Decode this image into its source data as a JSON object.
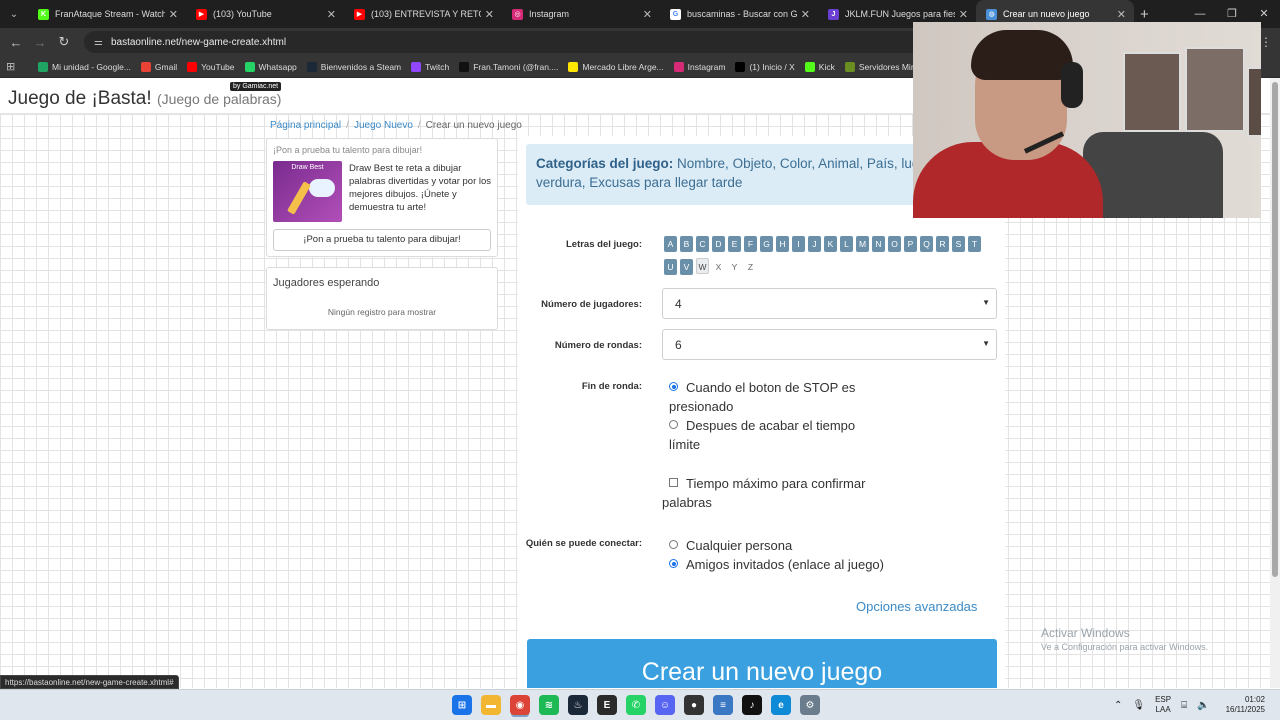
{
  "browser": {
    "tabs": [
      {
        "label": "FranAtaque Stream - Watch Liv",
        "fav_color": "#53fc18",
        "fav_glyph": "K"
      },
      {
        "label": "(103) YouTube",
        "fav_color": "#ff0000",
        "fav_glyph": "▶"
      },
      {
        "label": "(103) ENTREVISTA Y RETOS EN",
        "fav_color": "#ff0000",
        "fav_glyph": "▶"
      },
      {
        "label": "Instagram",
        "fav_color": "#d62976",
        "fav_glyph": "◎"
      },
      {
        "label": "buscaminas - Buscar con Goog",
        "fav_color": "#ffffff",
        "fav_glyph": "G"
      },
      {
        "label": "JKLM.FUN Juegos para fiestas e",
        "fav_color": "#6a3fd1",
        "fav_glyph": "J"
      },
      {
        "label": "Crear un nuevo juego",
        "fav_color": "#4a90d9",
        "fav_glyph": "◍"
      }
    ],
    "url": "bastaonline.net/new-game-create.xhtml",
    "bookmarks": [
      {
        "label": "Mi unidad - Google...",
        "color": "#1fa463"
      },
      {
        "label": "Gmail",
        "color": "#ea4335"
      },
      {
        "label": "YouTube",
        "color": "#ff0000"
      },
      {
        "label": "Whatsapp",
        "color": "#25d366"
      },
      {
        "label": "Bienvenidos a Steam",
        "color": "#1b2838"
      },
      {
        "label": "Twitch",
        "color": "#9146ff"
      },
      {
        "label": "Fran.Tamoni (@fran....",
        "color": "#111111"
      },
      {
        "label": "Mercado Libre Arge...",
        "color": "#ffe600"
      },
      {
        "label": "Instagram",
        "color": "#d62976"
      },
      {
        "label": "(1) Inicio / X",
        "color": "#000000"
      },
      {
        "label": "Kick",
        "color": "#53fc18"
      },
      {
        "label": "Servidores Minecraf...",
        "color": "#6b8e23"
      }
    ]
  },
  "site": {
    "title": "Juego de ¡Basta!",
    "subtitle": "(Juego de palabras)",
    "badge": "by Gamiac.net",
    "breadcrumb": {
      "home": "Página principal",
      "new": "Juego Nuevo",
      "current": "Crear un nuevo juego"
    }
  },
  "promo": {
    "heading": "¡Pon a prueba tu talento para dibujar!",
    "image_caption": "Draw Best",
    "text": "Draw Best te reta a dibujar palabras divertidas y votar por los mejores dibujos. ¡Únete y demuestra tu arte!",
    "button": "¡Pon a prueba tu talento para dibujar!"
  },
  "waiting": {
    "title": "Jugadores esperando",
    "empty": "Ningún registro para mostrar"
  },
  "form": {
    "categories_label": "Categorías del juego:",
    "categories_text": "Nombre, Objeto, Color, Animal, País, lugar, Fruta o verdura, Excusas para llegar tarde",
    "letters_label": "Letras del juego:",
    "letters_selected": [
      "A",
      "B",
      "C",
      "D",
      "E",
      "F",
      "G",
      "H",
      "I",
      "J",
      "K",
      "L",
      "M",
      "N",
      "O",
      "P",
      "Q",
      "R",
      "S",
      "T",
      "U",
      "V"
    ],
    "letter_hover": "W",
    "letters_unselected": [
      "X",
      "Y",
      "Z"
    ],
    "players_label": "Número de jugadores:",
    "players_value": "4",
    "rounds_label": "Número de rondas:",
    "rounds_value": "6",
    "round_end_label": "Fin de ronda:",
    "round_end_opt1": "Cuando el boton de STOP es presionado",
    "round_end_opt2": "Despues de acabar el tiempo límite",
    "max_time": "Tiempo máximo para confirmar palabras",
    "connect_label": "Quién se puede conectar:",
    "connect_opt1": "Cualquier persona",
    "connect_opt2": "Amigos invitados (enlace al juego)",
    "advanced": "Opciones avanzadas",
    "create_button": "Crear un nuevo juego"
  },
  "status_url": "https://bastaonline.net/new-game-create.xhtml#",
  "windows_activation": {
    "line1": "Activar Windows",
    "line2": "Ve a Configuración para activar Windows."
  },
  "taskbar": {
    "apps": [
      {
        "name": "windows-start-icon",
        "color": "#1a73e8",
        "glyph": "⊞"
      },
      {
        "name": "file-explorer-icon",
        "color": "#f2b632",
        "glyph": "▬"
      },
      {
        "name": "chrome-icon",
        "color": "#db4437",
        "glyph": "◉"
      },
      {
        "name": "spotify-icon",
        "color": "#1db954",
        "glyph": "≋"
      },
      {
        "name": "steam-icon",
        "color": "#1b2838",
        "glyph": "♨"
      },
      {
        "name": "epic-games-icon",
        "color": "#2a2a2a",
        "glyph": "E"
      },
      {
        "name": "whatsapp-icon",
        "color": "#25d366",
        "glyph": "✆"
      },
      {
        "name": "discord-icon",
        "color": "#5865f2",
        "glyph": "☺"
      },
      {
        "name": "obs-icon",
        "color": "#333333",
        "glyph": "●"
      },
      {
        "name": "notepad-icon",
        "color": "#3b78c4",
        "glyph": "≡"
      },
      {
        "name": "tiktok-icon",
        "color": "#111111",
        "glyph": "♪"
      },
      {
        "name": "edge-icon",
        "color": "#0f8ad6",
        "glyph": "e"
      },
      {
        "name": "settings-icon",
        "color": "#6b7c8c",
        "glyph": "⚙"
      }
    ],
    "lang_top": "ESP",
    "lang_bottom": "LAA",
    "time": "01:02",
    "date": "16/11/2025"
  }
}
